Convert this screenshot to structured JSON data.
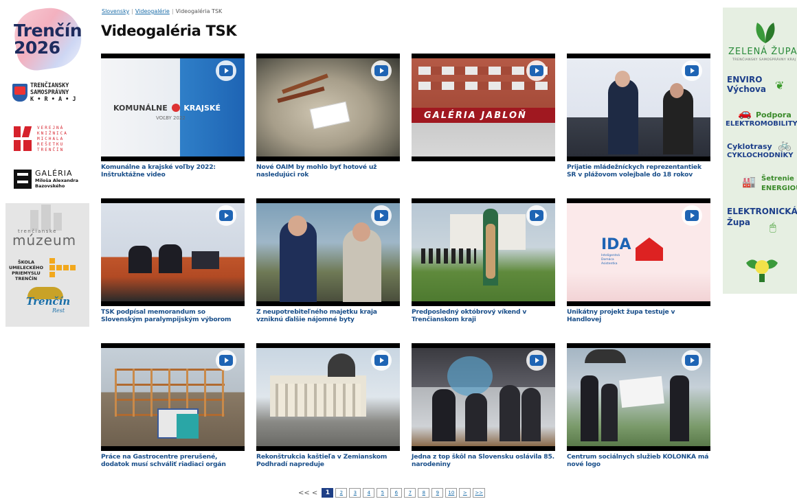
{
  "breadcrumb": {
    "items": [
      "Slovensky",
      "Videogalérie",
      "Videogaléria TSK"
    ],
    "separator": "|"
  },
  "page": {
    "title": "Videogaléria TSK"
  },
  "sidebar_logos": {
    "trencin2026": {
      "line1": "Trenčín",
      "line2": "2026"
    },
    "tsk": {
      "line1": "TRENČIANSKY",
      "line2": "SAMOSPRÁVNY",
      "line3": "K • R • A • J"
    },
    "vkmr": {
      "line1": "VEREJNÁ",
      "line2": "KNIŽNICA",
      "line3": "MICHALA",
      "line4": "REŠETKU",
      "line5": "TRENČÍN"
    },
    "galeria": {
      "line1": "GALÉRIA",
      "line2": "Miloša Alexandra",
      "line3": "Bazovského"
    },
    "muzeum": {
      "small": "trenčianske",
      "big": "múzeum"
    },
    "skola": {
      "line1": "ŠKOLA",
      "line2": "UMELECKÉHO",
      "line3": "PRIEMYSLU",
      "line4": "TRENČÍN"
    },
    "trencin_rest": {
      "word": "Trenčín",
      "tag": "Rest"
    }
  },
  "videos": [
    {
      "caption": "Komunálne a krajské voľby 2022: Inštruktážne video",
      "thumb_text1": "KOMUNÁLNE",
      "thumb_text2": "KRAJSKÉ",
      "thumb_text3": "VOĽBY 2022"
    },
    {
      "caption": "Nové OAIM by mohlo byť hotové už nasledujúci rok"
    },
    {
      "caption": "",
      "thumb_text1": "GALÉRIA JABLOŇ"
    },
    {
      "caption": "Prijatie mládežníckych reprezentantiek SR v plážovom volejbale do 18 rokov"
    },
    {
      "caption": "TSK podpísal memorandum so Slovenským paralympijským výborom"
    },
    {
      "caption": "Z neupotrebiteľného majetku kraja vzniknú ďalšie nájomné byty"
    },
    {
      "caption": "Predposledný októbrový víkend v Trenčianskom kraji"
    },
    {
      "caption": "Unikátny projekt župa testuje v Handlovej",
      "thumb_text1": "IDA",
      "thumb_text2": "Inteligentná",
      "thumb_text3": "Domáca",
      "thumb_text4": "Asistentka"
    },
    {
      "caption": "Práce na Gastrocentre prerušené, dodatok musí schváliť riadiaci orgán"
    },
    {
      "caption": "Rekonštrukcia kaštieľa v Zemianskom Podhradí napreduje"
    },
    {
      "caption": "Jedna z top škôl na Slovensku oslávila 85. narodeniny"
    },
    {
      "caption": "Centrum sociálnych služieb KOLONKA má nové logo"
    }
  ],
  "pagination": {
    "prev_label": "<< <",
    "pages": [
      "1",
      "2",
      "3",
      "4",
      "5",
      "6",
      "7",
      "8",
      "9",
      "10"
    ],
    "current": "1",
    "next": ">",
    "last": ">>"
  },
  "right_ad": {
    "title": "ZELENÁ ŽUPA",
    "subtitle": "TRENČIANSKY SAMOSPRÁVNY KRAJ",
    "items": [
      {
        "l1": "ENVIRO",
        "l2": "Výchova"
      },
      {
        "l1": "Podpora",
        "l2": "ELEKTROMOBILITY"
      },
      {
        "l1": "Cyklotrasy",
        "l2": "CYKLOCHODNÍKY"
      },
      {
        "l1": "Šetrenie",
        "l2": "ENERGIOU"
      },
      {
        "l1": "ELEKTRONICKÁ",
        "l2": "Župa"
      }
    ],
    "accent": "#2a8a3a"
  },
  "colors": {
    "link": "#1a6ca8",
    "caption": "#1a4f8a",
    "play": "#1e64b4",
    "active_page": "#1e3f86"
  }
}
